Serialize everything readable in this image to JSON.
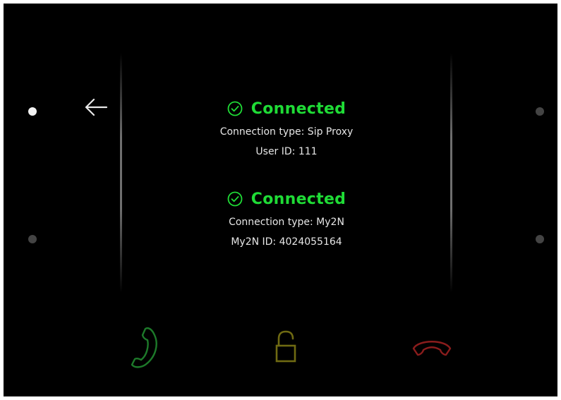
{
  "navigation": {
    "back_icon": "arrow-left-icon",
    "page_dots": {
      "left_top": "active",
      "left_bottom": "inactive",
      "right_top": "inactive",
      "right_bottom": "inactive"
    }
  },
  "connections": [
    {
      "status": "Connected",
      "status_icon": "check-circle-icon",
      "type_line": "Connection type: Sip Proxy",
      "id_line": "User ID: 111"
    },
    {
      "status": "Connected",
      "status_icon": "check-circle-icon",
      "type_line": "Connection type: My2N",
      "id_line": "My2N ID: 4024055164"
    }
  ],
  "actions": {
    "answer_icon": "phone-answer-icon",
    "unlock_icon": "unlock-icon",
    "hangup_icon": "phone-hangup-icon"
  },
  "colors": {
    "background": "#000000",
    "connected": "#1fdc36",
    "answer": "#1d7a2a",
    "unlock": "#6f6a12",
    "hangup": "#8a1c1c",
    "text": "#e6e6e6"
  }
}
